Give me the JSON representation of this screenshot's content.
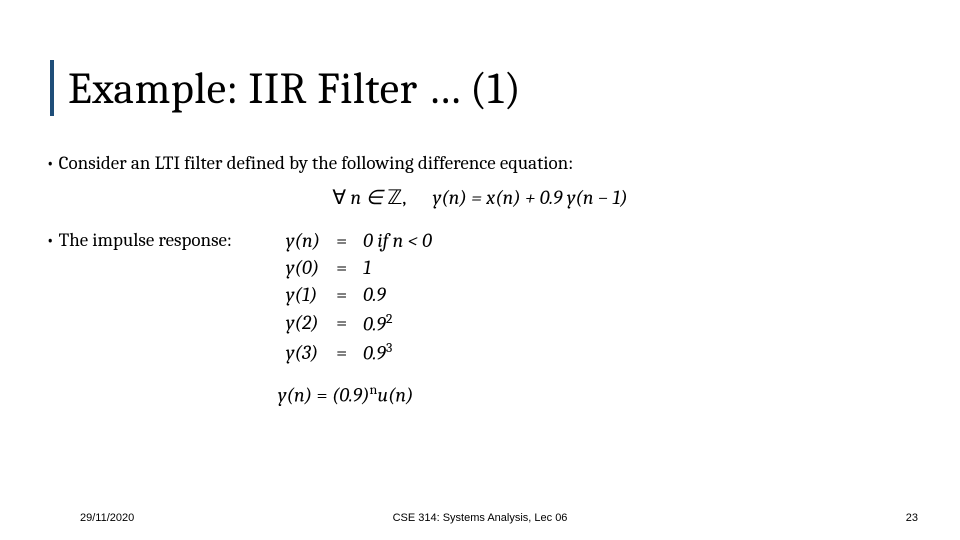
{
  "title": "Example: IIR Filter … (1)",
  "bullet1": "Consider an LTI filter defined by the following difference equation:",
  "eq1": {
    "forall": "∀",
    "nin": "n ∈",
    "Z": "ℤ",
    "comma": ",",
    "body": "y(n) = x(n) + 0.9 y(n − 1)"
  },
  "bullet2": "The impulse response:",
  "rows": [
    {
      "l": "y(n)",
      "r": "0   if n < 0"
    },
    {
      "l": "y(0)",
      "r": "1"
    },
    {
      "l": "y(1)",
      "r": "0.9"
    },
    {
      "l": "y(2)",
      "r": "0.9",
      "sup": "2"
    },
    {
      "l": "y(3)",
      "r": "0.9",
      "sup": "3"
    }
  ],
  "closed": {
    "l": "y(n)",
    "r1": "(0.9)",
    "exp": "n",
    "r2": "u(n)"
  },
  "footer": {
    "date": "29/11/2020",
    "course": "CSE 314: Systems Analysis, Lec 06",
    "page": "23"
  }
}
